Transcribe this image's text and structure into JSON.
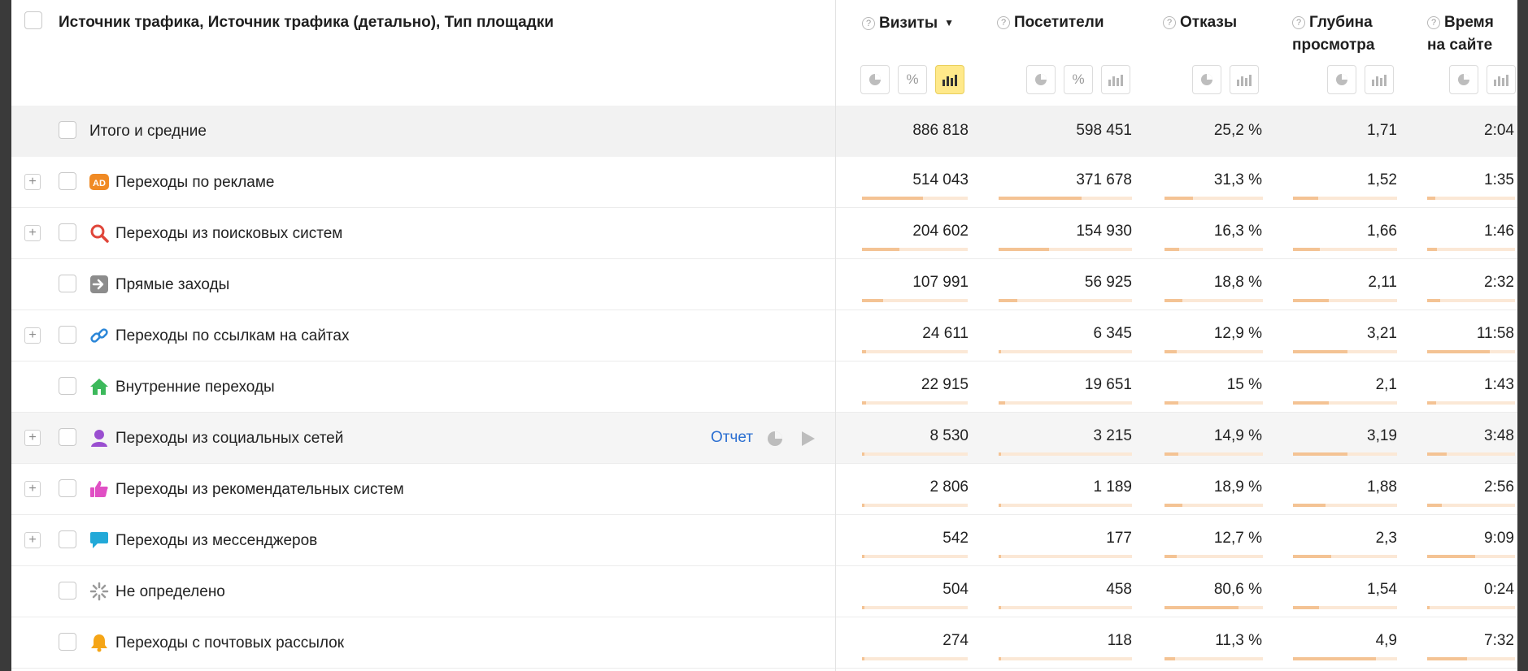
{
  "header": {
    "dimensions_label": "Источник трафика, Источник трафика (детально), Тип площадки",
    "question_mark": "?",
    "sort_indicator": "▼",
    "metrics": [
      {
        "key": "visits",
        "label": "Визиты",
        "sorted": true
      },
      {
        "key": "visitors",
        "label": "Посетители"
      },
      {
        "key": "bounce",
        "label": "Отказы"
      },
      {
        "key": "depth",
        "label": "Глубина просмотра"
      },
      {
        "key": "time",
        "label": "Время на сайте"
      }
    ],
    "tool_labels": {
      "percent": "%"
    }
  },
  "total_row": {
    "label": "Итого и средние",
    "values": [
      "886 818",
      "598 451",
      "25,2 %",
      "1,71",
      "2:04"
    ]
  },
  "rows": [
    {
      "label": "Переходы по рекламе",
      "icon": "ad-icon",
      "expandable": true,
      "values": [
        "514 043",
        "371 678",
        "31,3 %",
        "1,52",
        "1:35"
      ],
      "share": [
        0.58,
        0.62,
        0.29,
        0.24,
        0.09
      ]
    },
    {
      "label": "Переходы из поисковых систем",
      "icon": "search-icon",
      "expandable": true,
      "values": [
        "204 602",
        "154 930",
        "16,3 %",
        "1,66",
        "1:46"
      ],
      "share": [
        0.35,
        0.38,
        0.15,
        0.26,
        0.11
      ]
    },
    {
      "label": "Прямые заходы",
      "icon": "direct-entry-icon",
      "expandable": false,
      "values": [
        "107 991",
        "56 925",
        "18,8 %",
        "2,11",
        "2:32"
      ],
      "share": [
        0.2,
        0.14,
        0.18,
        0.34,
        0.15
      ]
    },
    {
      "label": "Переходы по ссылкам на сайтах",
      "icon": "link-icon",
      "expandable": true,
      "values": [
        "24 611",
        "6 345",
        "12,9 %",
        "3,21",
        "11:58"
      ],
      "share": [
        0.04,
        0.02,
        0.12,
        0.52,
        0.71
      ]
    },
    {
      "label": "Внутренние переходы",
      "icon": "home-icon",
      "expandable": false,
      "values": [
        "22 915",
        "19 651",
        "15 %",
        "2,1",
        "1:43"
      ],
      "share": [
        0.04,
        0.05,
        0.14,
        0.34,
        0.1
      ]
    },
    {
      "label": "Переходы из социальных сетей",
      "icon": "social-user-icon",
      "expandable": true,
      "hover": true,
      "report_link": "Отчет",
      "values": [
        "8 530",
        "3 215",
        "14,9 %",
        "3,19",
        "3:48"
      ],
      "share": [
        0.02,
        0.01,
        0.14,
        0.52,
        0.22
      ]
    },
    {
      "label": "Переходы из рекомендательных систем",
      "icon": "thumbs-up-icon",
      "expandable": true,
      "values": [
        "2 806",
        "1 189",
        "18,9 %",
        "1,88",
        "2:56"
      ],
      "share": [
        0.01,
        0.01,
        0.18,
        0.31,
        0.17
      ]
    },
    {
      "label": "Переходы из мессенджеров",
      "icon": "chat-icon",
      "expandable": true,
      "values": [
        "542",
        "177",
        "12,7 %",
        "2,3",
        "9:09"
      ],
      "share": [
        0.004,
        0.003,
        0.12,
        0.37,
        0.55
      ]
    },
    {
      "label": "Не определено",
      "icon": "spinner-icon",
      "expandable": false,
      "values": [
        "504",
        "458",
        "80,6 %",
        "1,54",
        "0:24"
      ],
      "share": [
        0.004,
        0.003,
        0.75,
        0.25,
        0.03
      ]
    },
    {
      "label": "Переходы с почтовых рассылок",
      "icon": "bell-icon",
      "expandable": false,
      "values": [
        "274",
        "118",
        "11,3 %",
        "4,9",
        "7:32"
      ],
      "share": [
        0.003,
        0.002,
        0.11,
        0.8,
        0.45
      ]
    }
  ]
}
